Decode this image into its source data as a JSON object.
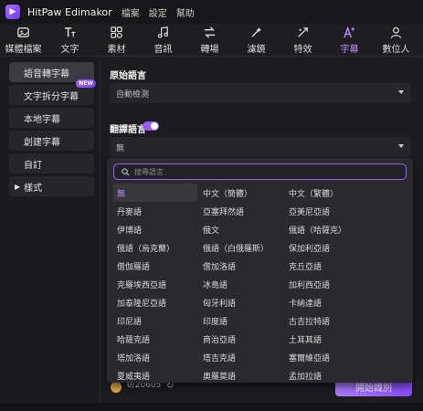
{
  "app": {
    "title": "HitPaw Edimakor"
  },
  "menu": [
    "檔案",
    "設定",
    "幫助"
  ],
  "toolbar": [
    {
      "label": "媒體檔案",
      "icon": "media-icon"
    },
    {
      "label": "文字",
      "icon": "text-icon"
    },
    {
      "label": "素材",
      "icon": "assets-icon"
    },
    {
      "label": "音訊",
      "icon": "music-icon"
    },
    {
      "label": "轉場",
      "icon": "transition-icon"
    },
    {
      "label": "濾鏡",
      "icon": "filter-icon"
    },
    {
      "label": "特效",
      "icon": "effects-icon"
    },
    {
      "label": "字幕",
      "icon": "subtitle-icon",
      "active": true
    },
    {
      "label": "數位人",
      "icon": "avatar-icon"
    }
  ],
  "sidebar": {
    "items": [
      {
        "label": "語音轉字幕",
        "active": true
      },
      {
        "label": "文字拆分字幕",
        "badge": "NEW"
      },
      {
        "label": "本地字幕"
      },
      {
        "label": "創建字幕"
      },
      {
        "label": "自訂"
      },
      {
        "label": "樣式",
        "expandable": true
      }
    ]
  },
  "main": {
    "source_label": "原始語言",
    "source_value": "自動檢測",
    "translate_label": "翻譯語言",
    "translate_enabled": true,
    "translate_value": "無"
  },
  "dropdown": {
    "search_placeholder": "搜尋語言",
    "options": [
      "無",
      "中文（簡體）",
      "中文（繁體）",
      "丹麥語",
      "亞塞拜然語",
      "亞美尼亞語",
      "伊博語",
      "俄文",
      "俄語（哈薩克）",
      "俄語（烏克蘭）",
      "俄語（白俄羅斯）",
      "保加利亞語",
      "僧伽羅語",
      "僧加洛語",
      "克丘亞語",
      "克羅埃西亞語",
      "冰島語",
      "加利西亞語",
      "加泰隆尼亞語",
      "匈牙利語",
      "卡納達語",
      "印尼語",
      "印度語",
      "古吉拉特語",
      "哈薩克語",
      "商治亞語",
      "土耳其語",
      "塔加洛語",
      "塔吉克語",
      "塞爾維亞語",
      "夏威夷語",
      "奧羅莫語",
      "孟加拉語"
    ],
    "selected": "無"
  },
  "footer": {
    "credits": "0/20605",
    "start_label": "開始識別"
  },
  "colors": {
    "accent": "#9a5cff",
    "background": "#1b1b1e"
  }
}
